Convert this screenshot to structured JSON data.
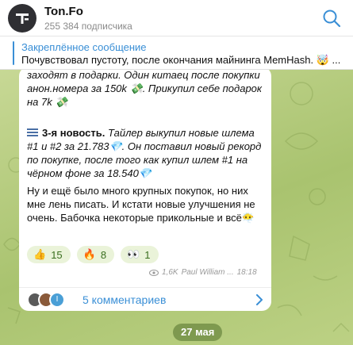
{
  "header": {
    "title": "Ton.Fo",
    "subscribers": "255 384 подписчика"
  },
  "pinned": {
    "title": "Закреплённое сообщение",
    "text": "Почувствовал пустоту, после окончания майнинга MemHash. 🤯 ..."
  },
  "post": {
    "p1": "заходят в подарки. Один китаец после покупки анон.номера за 150k 💸. Прикупил себе подарок на 7k 💸",
    "p2_lead": "3-я новость.",
    "p2_rest": " Тайлер выкупил новые шлема #1 и #2 за 21.783💎. Он поставил новый рекорд по покупке, после того как купил шлем #1 на чёрном фоне за 18.540💎",
    "p3": "Ну и ещё было много крупных покупок, но них мне лень писать. И кстати новые улучшения не очень. Бабочка некоторые прикольные и всё😶‍🌫️",
    "reactions": [
      {
        "emoji": "👍",
        "count": "15"
      },
      {
        "emoji": "🔥",
        "count": "8"
      },
      {
        "emoji": "👀",
        "count": "1"
      }
    ],
    "views": "1,6K",
    "author": "Paul William ...",
    "time": "18:18",
    "comments_label": "5 комментариев",
    "comment_avatar_letter": "I"
  },
  "date_separator": "27 мая",
  "colors": {
    "accent": "#3a8fd6",
    "chat_background": "#b7cc86",
    "reaction_bg": "#eaf3d9"
  }
}
